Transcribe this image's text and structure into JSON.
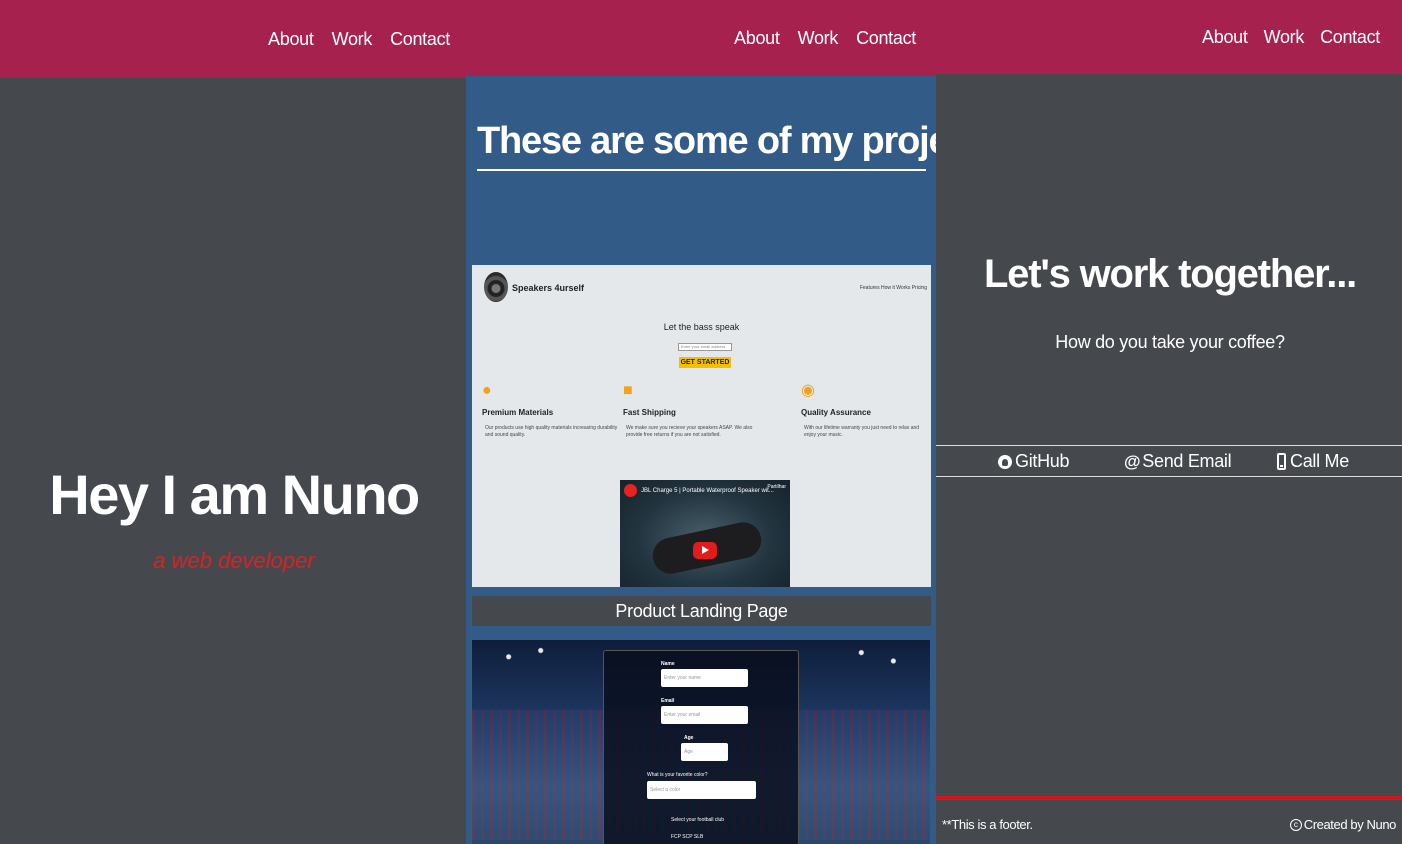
{
  "nav": {
    "about": "About",
    "work": "Work",
    "contact": "Contact"
  },
  "welcome": {
    "title": "Hey I am Nuno",
    "subtitle": "a web developer"
  },
  "projects": {
    "heading": "These are some of my projects",
    "landing_page": {
      "brand": "Speakers 4urself",
      "nav_links": "Features  How it Works  Pricing",
      "headline": "Let the bass speak",
      "email_placeholder": "Enter your email address",
      "cta": "GET STARTED",
      "features": [
        {
          "icon": "fire-icon",
          "title": "Premium Materials",
          "desc": "Our products use high quality materials increasing durability and sound quality."
        },
        {
          "icon": "truck-icon",
          "title": "Fast Shipping",
          "desc": "We make sure you recieve your speakers ASAP. We also provide free returns if you are not satisfied."
        },
        {
          "icon": "award-icon",
          "title": "Quality Assurance",
          "desc": "With our lifetime warranty you just need to relax and enjoy your music."
        }
      ],
      "video_title": "JBL Charge 5 | Portable Waterproof Speaker wit...",
      "video_share": "Partilhar"
    },
    "caption": "Product Landing Page",
    "survey_form": {
      "name_label": "Name",
      "name_placeholder": "Enter your name",
      "email_label": "Email",
      "email_placeholder": "Enter your email",
      "age_label": "Age",
      "age_placeholder": "Age",
      "color_label": "What is your favorite color?",
      "color_select": "Select a color",
      "club_label": "Select your football club",
      "clubs": "FCP  SCP  SLB"
    }
  },
  "contact": {
    "title": "Let's work together...",
    "subtitle": "How do you take your coffee?",
    "links": {
      "github": "GitHub",
      "email": "Send Email",
      "phone": "Call Me"
    }
  },
  "footer": {
    "left": "**This is a footer.",
    "right": "Created by Nuno"
  },
  "colors": {
    "nav": "#a7214e",
    "background": "#45494e",
    "projects_bg": "#325b87",
    "accent_red": "#d3161c"
  }
}
